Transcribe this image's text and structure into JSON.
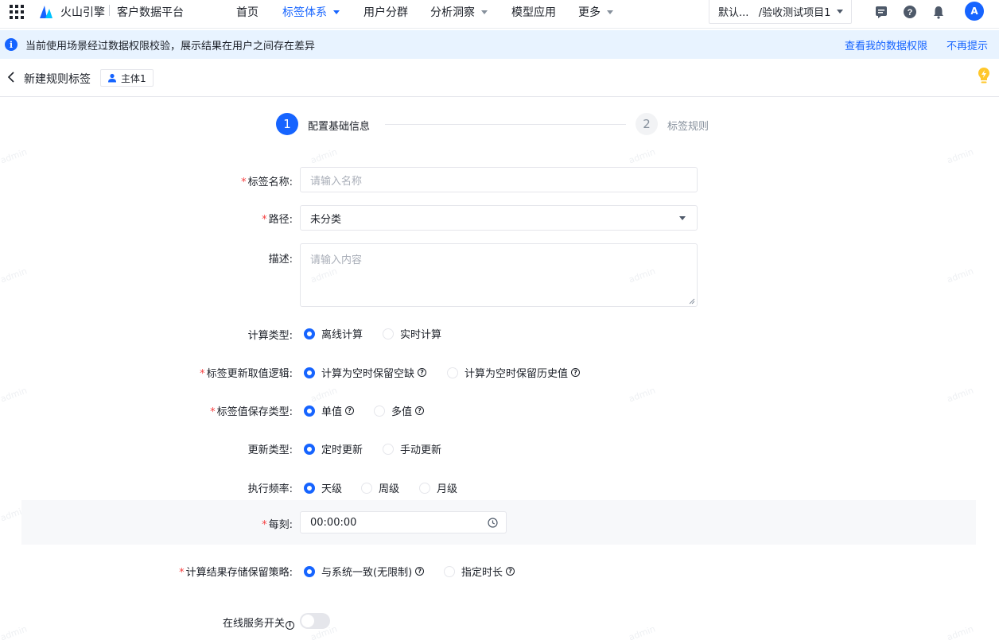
{
  "topbar": {
    "brand": "火山引擎",
    "product": "客户数据平台",
    "nav": [
      {
        "label": "首页",
        "active": false,
        "dropdown": false
      },
      {
        "label": "标签体系",
        "active": true,
        "dropdown": true
      },
      {
        "label": "用户分群",
        "active": false,
        "dropdown": false
      },
      {
        "label": "分析洞察",
        "active": false,
        "dropdown": true
      },
      {
        "label": "模型应用",
        "active": false,
        "dropdown": false
      },
      {
        "label": "更多",
        "active": false,
        "dropdown": true
      }
    ],
    "project_select": "默认...   /验收测试项目1",
    "avatar": "A",
    "icons": [
      "message-icon",
      "help-icon",
      "bell-icon"
    ]
  },
  "banner": {
    "text": "当前使用场景经过数据权限校验，展示结果在用户之间存在差异",
    "link_permissions": "查看我的数据权限",
    "link_dismiss": "不再提示"
  },
  "header": {
    "title": "新建规则标签",
    "subject_tag": "主体1"
  },
  "steps": [
    {
      "num": "1",
      "label": "配置基础信息",
      "active": true
    },
    {
      "num": "2",
      "label": "标签规则",
      "active": false
    }
  ],
  "form": {
    "name_label": "标签名称:",
    "name_placeholder": "请输入名称",
    "path_label": "路径:",
    "path_value": "未分类",
    "desc_label": "描述:",
    "desc_placeholder": "请输入内容",
    "calc_type_label": "计算类型:",
    "calc_type_options": [
      "离线计算",
      "实时计算"
    ],
    "update_logic_label": "标签更新取值逻辑:",
    "update_logic_options": [
      "计算为空时保留空缺",
      "计算为空时保留历史值"
    ],
    "value_type_label": "标签值保存类型:",
    "value_type_options": [
      "单值",
      "多值"
    ],
    "update_type_label": "更新类型:",
    "update_type_options": [
      "定时更新",
      "手动更新"
    ],
    "frequency_label": "执行频率:",
    "frequency_options": [
      "天级",
      "周级",
      "月级"
    ],
    "time_label": "每刻:",
    "time_value": "00:00:00",
    "retention_label": "计算结果存储保留策略:",
    "retention_options": [
      "与系统一致(无限制)",
      "指定时长"
    ],
    "online_label": "在线服务开关",
    "online_on": false
  },
  "watermark": "admin",
  "colors": {
    "primary": "#1664ff",
    "required": "#f53f3f",
    "banner_bg": "#e8f3ff"
  }
}
